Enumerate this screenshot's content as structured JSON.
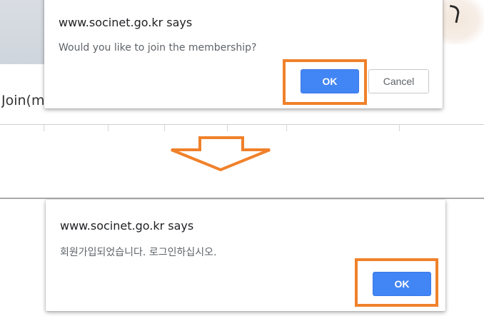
{
  "top_dialog": {
    "title": "www.socinet.go.kr says",
    "message": "Would you like to join the membership?",
    "ok_label": "OK",
    "cancel_label": "Cancel"
  },
  "bottom_dialog": {
    "title": "www.socinet.go.kr says",
    "message": "회원가입되었습니다. 로그인하십시오.",
    "ok_label": "OK"
  },
  "background": {
    "join_text": "Join(m"
  },
  "colors": {
    "accent_button": "#4285f4",
    "highlight": "#f0812a",
    "arrow": "#f0812a"
  },
  "icons": {
    "transition_arrow": "down-arrow-outline-icon"
  }
}
